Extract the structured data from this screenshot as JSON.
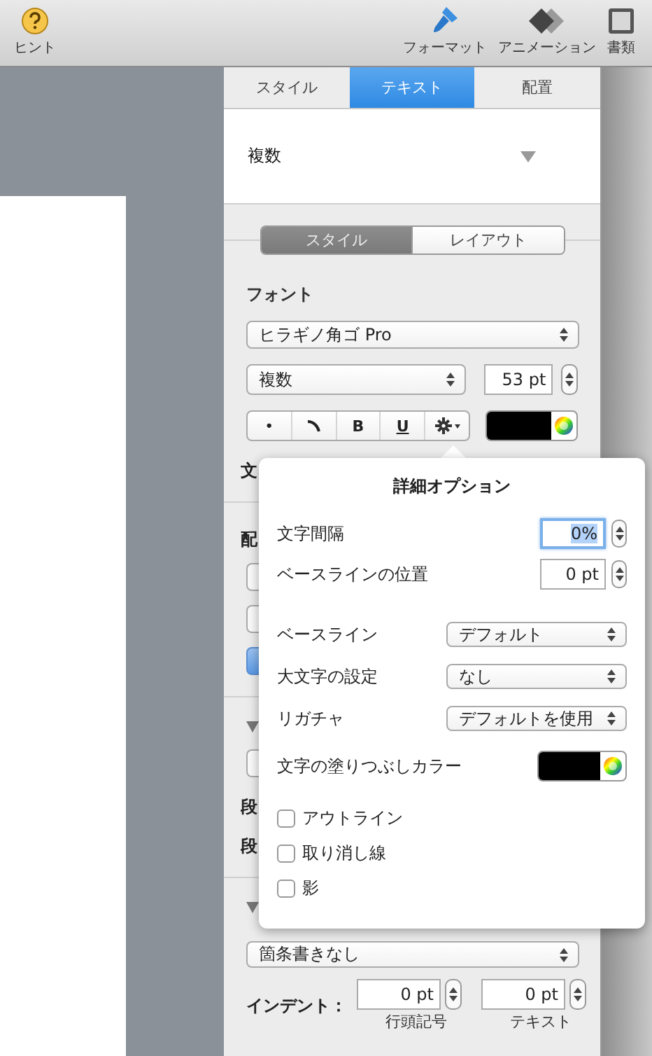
{
  "toolbar": {
    "items": [
      {
        "kind": "hint",
        "label": "ヒント"
      },
      {
        "kind": "format",
        "label": "フォーマット"
      },
      {
        "kind": "animation",
        "label": "アニメーション"
      },
      {
        "kind": "document",
        "label": "書類"
      }
    ]
  },
  "inspector": {
    "tabs": [
      {
        "label": "スタイル",
        "selected": false
      },
      {
        "label": "テキスト",
        "selected": true
      },
      {
        "label": "配置",
        "selected": false
      }
    ],
    "paragraph_style": "複数",
    "segments": [
      {
        "label": "スタイル",
        "selected": true
      },
      {
        "label": "レイアウト",
        "selected": false
      }
    ],
    "font_heading": "フォント",
    "font_family": "ヒラギノ角ゴ Pro",
    "typeface": "複数",
    "size": "53 pt",
    "style_buttons": [
      {
        "kind": "text",
        "label": "•"
      },
      {
        "kind": "curve"
      },
      {
        "kind": "bold",
        "label": "B"
      },
      {
        "kind": "underline",
        "label": "U"
      },
      {
        "kind": "gear"
      }
    ],
    "covered": [
      {
        "kind": "label",
        "label": "文"
      },
      {
        "kind": "divider"
      },
      {
        "kind": "label",
        "label": "配"
      },
      {
        "kind": "button",
        "selected": false
      },
      {
        "kind": "button",
        "selected": false
      },
      {
        "kind": "button",
        "selected": true
      },
      {
        "kind": "divider"
      },
      {
        "kind": "disclosure",
        "expanded": true
      },
      {
        "kind": "button",
        "selected": false
      },
      {
        "kind": "label",
        "label": "段"
      },
      {
        "kind": "label",
        "label": "段"
      },
      {
        "kind": "divider"
      },
      {
        "kind": "disclosure",
        "expanded": true
      }
    ],
    "bullets": "箇条書きなし",
    "indent": {
      "label": "インデント：",
      "fields": [
        {
          "value": "0 pt",
          "caption": "行頭記号"
        },
        {
          "value": "0 pt",
          "caption": "テキスト"
        }
      ]
    }
  },
  "popover": {
    "title": "詳細オプション",
    "fields": [
      {
        "label": "文字間隔",
        "value": "0%",
        "selected": true
      },
      {
        "label": "ベースラインの位置",
        "value": "0 pt",
        "selected": false
      }
    ],
    "popups": [
      {
        "label": "ベースライン",
        "value": "デフォルト"
      },
      {
        "label": "大文字の設定",
        "value": "なし"
      },
      {
        "label": "リガチャ",
        "value": "デフォルトを使用"
      }
    ],
    "fill_color_label": "文字の塗りつぶしカラー",
    "checkboxes": [
      {
        "label": "アウトライン",
        "checked": false
      },
      {
        "label": "取り消し線",
        "checked": false
      },
      {
        "label": "影",
        "checked": false
      }
    ]
  }
}
